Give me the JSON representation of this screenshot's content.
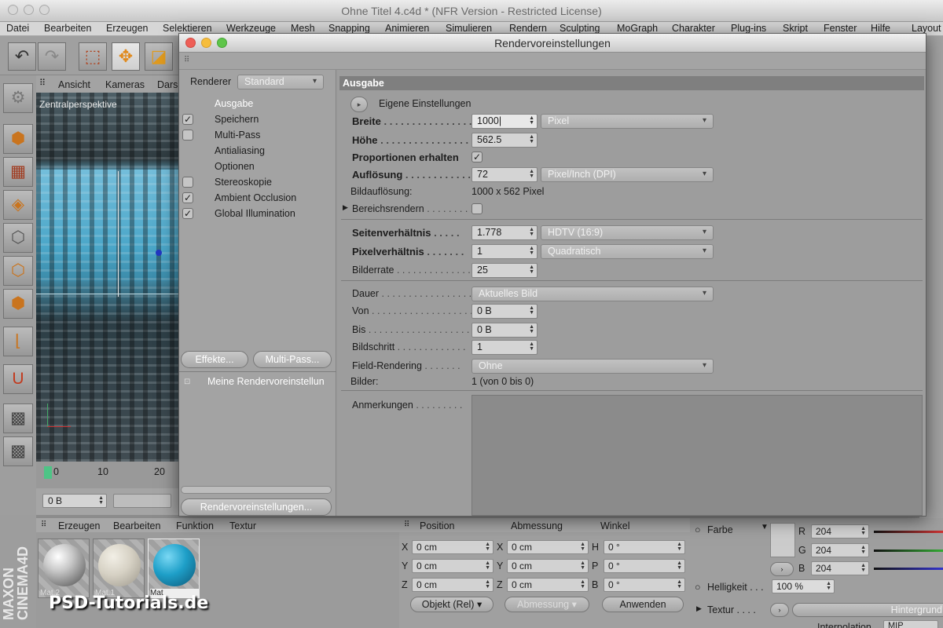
{
  "app": {
    "window_title": "Ohne Titel 4.c4d * (NFR Version - Restricted License)",
    "menu": [
      "Datei",
      "Bearbeiten",
      "Erzeugen",
      "Selektieren",
      "Werkzeuge",
      "Mesh",
      "Snapping",
      "Animieren",
      "Simulieren",
      "Rendern",
      "Sculpting",
      "MoGraph",
      "Charakter",
      "Plug-ins",
      "Skript",
      "Fenster",
      "Hilfe",
      "Layout"
    ],
    "viewport_menu": [
      "Ansicht",
      "Kameras",
      "Dars"
    ],
    "viewport_label": "Zentralperspektive",
    "timeline_ticks": [
      "0",
      "10",
      "20"
    ],
    "time_field": "0 B",
    "brand": "MAXON CINEMA4D",
    "watermark": "PSD-Tutorials.de"
  },
  "dialog": {
    "title": "Rendervoreinstellungen",
    "renderer_label": "Renderer",
    "renderer_value": "Standard",
    "nav": [
      {
        "label": "Ausgabe",
        "checkbox": "none"
      },
      {
        "label": "Speichern",
        "checkbox": "checked"
      },
      {
        "label": "Multi-Pass",
        "checkbox": "unchecked"
      },
      {
        "label": "Antialiasing",
        "checkbox": "none"
      },
      {
        "label": "Optionen",
        "checkbox": "none"
      },
      {
        "label": "Stereoskopie",
        "checkbox": "unchecked"
      },
      {
        "label": "Ambient Occlusion",
        "checkbox": "checked"
      },
      {
        "label": "Global Illumination",
        "checkbox": "checked"
      }
    ],
    "effekte_button": "Effekte...",
    "multipass_button": "Multi-Pass...",
    "preset_name": "Meine Rendervoreinstellun",
    "presets_button": "Rendervoreinstellungen...",
    "section_title": "Ausgabe",
    "eigene_einstellungen": "Eigene Einstellungen",
    "breite": {
      "label": "Breite",
      "value": "1000",
      "unit": "Pixel"
    },
    "hoehe": {
      "label": "Höhe",
      "value": "562.5"
    },
    "proportionen": {
      "label": "Proportionen erhalten",
      "checked": true
    },
    "aufloesung": {
      "label": "Auflösung",
      "value": "72",
      "unit": "Pixel/Inch (DPI)"
    },
    "bildaufloesung": {
      "label": "Bildauflösung:",
      "value": "1000 x 562 Pixel"
    },
    "bereichsrendern": {
      "label": "Bereichsrendern",
      "checked": false
    },
    "seitenverhaeltnis": {
      "label": "Seitenverhältnis",
      "value": "1.778",
      "preset": "HDTV (16:9)"
    },
    "pixelverhaeltnis": {
      "label": "Pixelverhältnis",
      "value": "1",
      "preset": "Quadratisch"
    },
    "bilderrate": {
      "label": "Bilderrate",
      "value": "25"
    },
    "dauer": {
      "label": "Dauer",
      "value": "Aktuelles Bild"
    },
    "von": {
      "label": "Von",
      "value": "0 B"
    },
    "bis": {
      "label": "Bis",
      "value": "0 B"
    },
    "bildschritt": {
      "label": "Bildschritt",
      "value": "1"
    },
    "field_rendering": {
      "label": "Field-Rendering",
      "value": "Ohne"
    },
    "bilder": {
      "label": "Bilder:",
      "value": "1 (von 0 bis 0)"
    },
    "anmerkungen": {
      "label": "Anmerkungen"
    }
  },
  "materials": {
    "menu": [
      "Erzeugen",
      "Bearbeiten",
      "Funktion",
      "Textur"
    ],
    "items": [
      "Mat.2",
      "Mat.1",
      "Mat"
    ]
  },
  "coords": {
    "headers": [
      "Position",
      "Abmessung",
      "Winkel"
    ],
    "rows": [
      {
        "a": "X",
        "av": "0 cm",
        "b": "X",
        "bv": "0 cm",
        "c": "H",
        "cv": "0 °"
      },
      {
        "a": "Y",
        "av": "0 cm",
        "b": "Y",
        "bv": "0 cm",
        "c": "P",
        "cv": "0 °"
      },
      {
        "a": "Z",
        "av": "0 cm",
        "b": "Z",
        "bv": "0 cm",
        "c": "B",
        "cv": "0 °"
      }
    ],
    "mode": "Objekt (Rel)",
    "size_mode": "Abmessung",
    "apply": "Anwenden"
  },
  "attributes": {
    "farbe": "Farbe",
    "r": "204",
    "g": "204",
    "b": "204",
    "helligkeit_label": "Helligkeit",
    "helligkeit": "100 %",
    "textur": "Textur",
    "hintergrund": "Hintergrund",
    "interpolation": "Interpolation",
    "interpolation_value": "MIP"
  }
}
